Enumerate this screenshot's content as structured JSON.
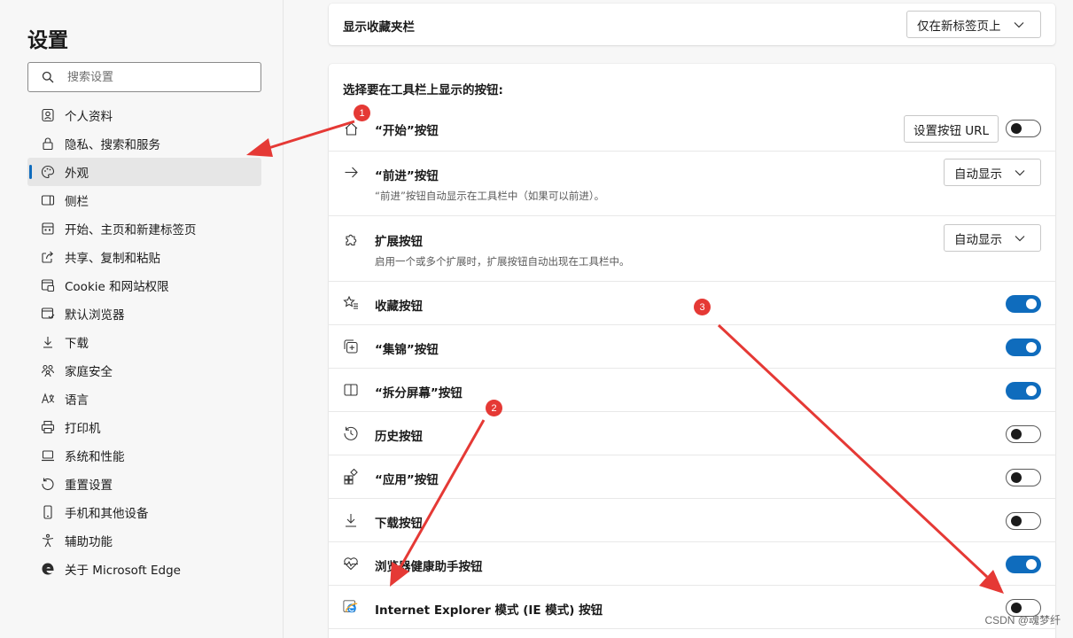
{
  "sidebar": {
    "title": "设置",
    "search_placeholder": "搜索设置",
    "items": [
      {
        "label": "个人资料",
        "icon": "profile-icon"
      },
      {
        "label": "隐私、搜索和服务",
        "icon": "lock-icon"
      },
      {
        "label": "外观",
        "icon": "palette-icon",
        "active": true
      },
      {
        "label": "侧栏",
        "icon": "sidebar-icon"
      },
      {
        "label": "开始、主页和新建标签页",
        "icon": "home-grid-icon"
      },
      {
        "label": "共享、复制和粘贴",
        "icon": "share-icon"
      },
      {
        "label": "Cookie 和网站权限",
        "icon": "cookie-icon"
      },
      {
        "label": "默认浏览器",
        "icon": "browser-icon"
      },
      {
        "label": "下载",
        "icon": "download-icon"
      },
      {
        "label": "家庭安全",
        "icon": "family-icon"
      },
      {
        "label": "语言",
        "icon": "language-icon"
      },
      {
        "label": "打印机",
        "icon": "printer-icon"
      },
      {
        "label": "系统和性能",
        "icon": "laptop-icon"
      },
      {
        "label": "重置设置",
        "icon": "reset-icon"
      },
      {
        "label": "手机和其他设备",
        "icon": "phone-icon"
      },
      {
        "label": "辅助功能",
        "icon": "accessibility-icon"
      },
      {
        "label": "关于 Microsoft Edge",
        "icon": "edge-icon"
      }
    ]
  },
  "favorites_bar": {
    "label": "显示收藏夹栏",
    "selected": "仅在新标签页上"
  },
  "toolbar": {
    "section_title": "选择要在工具栏上显示的按钮:",
    "home": {
      "label": "“开始”按钮",
      "button_label": "设置按钮 URL",
      "enabled": false
    },
    "forward": {
      "label": "“前进”按钮",
      "desc": "“前进”按钮自动显示在工具栏中（如果可以前进）。",
      "selected": "自动显示"
    },
    "extensions": {
      "label": "扩展按钮",
      "desc": "启用一个或多个扩展时，扩展按钮自动出现在工具栏中。",
      "selected": "自动显示"
    },
    "toggles": [
      {
        "label": "收藏按钮",
        "icon": "favorites-icon",
        "enabled": true
      },
      {
        "label": "“集锦”按钮",
        "icon": "collections-icon",
        "enabled": true
      },
      {
        "label": "“拆分屏幕”按钮",
        "icon": "split-screen-icon",
        "enabled": true
      },
      {
        "label": "历史按钮",
        "icon": "history-icon",
        "enabled": false
      },
      {
        "label": "“应用”按钮",
        "icon": "apps-icon",
        "enabled": false
      },
      {
        "label": "下载按钮",
        "icon": "download-icon",
        "enabled": false
      },
      {
        "label": "浏览器健康助手按钮",
        "icon": "heart-pulse-icon",
        "enabled": true
      },
      {
        "label": "Internet Explorer 模式 (IE 模式) 按钮",
        "icon": "ie-icon",
        "enabled": false
      }
    ]
  },
  "annotations": {
    "badges": [
      "1",
      "2",
      "3"
    ],
    "color": "#e53935"
  },
  "watermark": "CSDN @魂梦纤",
  "colors": {
    "accent": "#0f6cbd",
    "annotation": "#e53935"
  }
}
